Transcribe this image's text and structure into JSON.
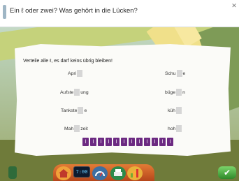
{
  "window": {
    "title": "Ein ℓ oder zwei? Was gehört in die Lücken?",
    "close_glyph": "✕"
  },
  "task": {
    "instruction": "Verteile alle ℓ, es darf keins übrig bleiben!",
    "words_left": [
      {
        "pre": "Apri",
        "post": ""
      },
      {
        "pre": "Aufste",
        "post": "ung"
      },
      {
        "pre": "Tankste",
        "post": "e"
      },
      {
        "pre": "Mah",
        "post": "zeit"
      }
    ],
    "words_right": [
      {
        "pre": "Schu",
        "post": "e"
      },
      {
        "pre": "büge",
        "post": "n"
      },
      {
        "pre": "küh",
        "post": ""
      },
      {
        "pre": "hoh",
        "post": ""
      }
    ],
    "tiles": [
      "l",
      "l",
      "l",
      "l",
      "l",
      "l",
      "l",
      "l",
      "l",
      "l",
      "l",
      "l"
    ]
  },
  "toolbar": {
    "clock_text": "7:00",
    "ok_glyph": "✔"
  },
  "colors": {
    "tile": "#6c2a82",
    "gap": "#d6d6d6",
    "toolbar": "#d2642a"
  }
}
